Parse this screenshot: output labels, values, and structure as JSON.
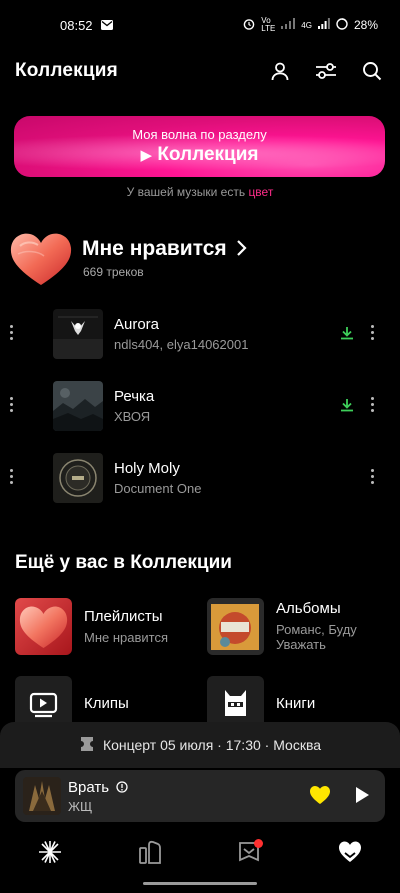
{
  "status_bar": {
    "time": "08:52",
    "network": "Vo LTE",
    "signal_label": "4G",
    "battery": "28%"
  },
  "header": {
    "title": "Коллекция",
    "icons": [
      "profile-icon",
      "filters-icon",
      "search-icon"
    ]
  },
  "wave": {
    "line1": "Моя волна по разделу",
    "line2": "Коллекция",
    "play_glyph": "▶"
  },
  "color_hint": {
    "text": "У вашей музыки есть ",
    "accent": "цвет",
    "accent_color": "#ff2d8a"
  },
  "likes": {
    "title": "Мне нравится",
    "count": "669 треков"
  },
  "tracks": [
    {
      "title": "Aurora",
      "artist": "ndls404, elya14062001",
      "downloaded": true
    },
    {
      "title": "Речка",
      "artist": "ХВОЯ",
      "downloaded": true
    },
    {
      "title": "Holy Moly",
      "artist": "Document One",
      "downloaded": false
    }
  ],
  "more_section": {
    "title": "Ещё у вас в Коллекции",
    "tiles": [
      {
        "label": "Плейлисты",
        "sub": "Мне нравится"
      },
      {
        "label": "Альбомы",
        "sub": "Романс, Буду Уважать"
      },
      {
        "label": "Клипы",
        "sub": ""
      },
      {
        "label": "Книги",
        "sub": ""
      }
    ]
  },
  "concert": {
    "text": "Концерт 05 июля · 17:30 · Москва"
  },
  "player": {
    "title": "Врать",
    "artist": "ЖЩ",
    "heart_color": "#ffe600"
  },
  "colors": {
    "accent": "#ff1493",
    "download": "#3ecf5a",
    "background": "#000000",
    "notification_dot": "#ff3030"
  }
}
